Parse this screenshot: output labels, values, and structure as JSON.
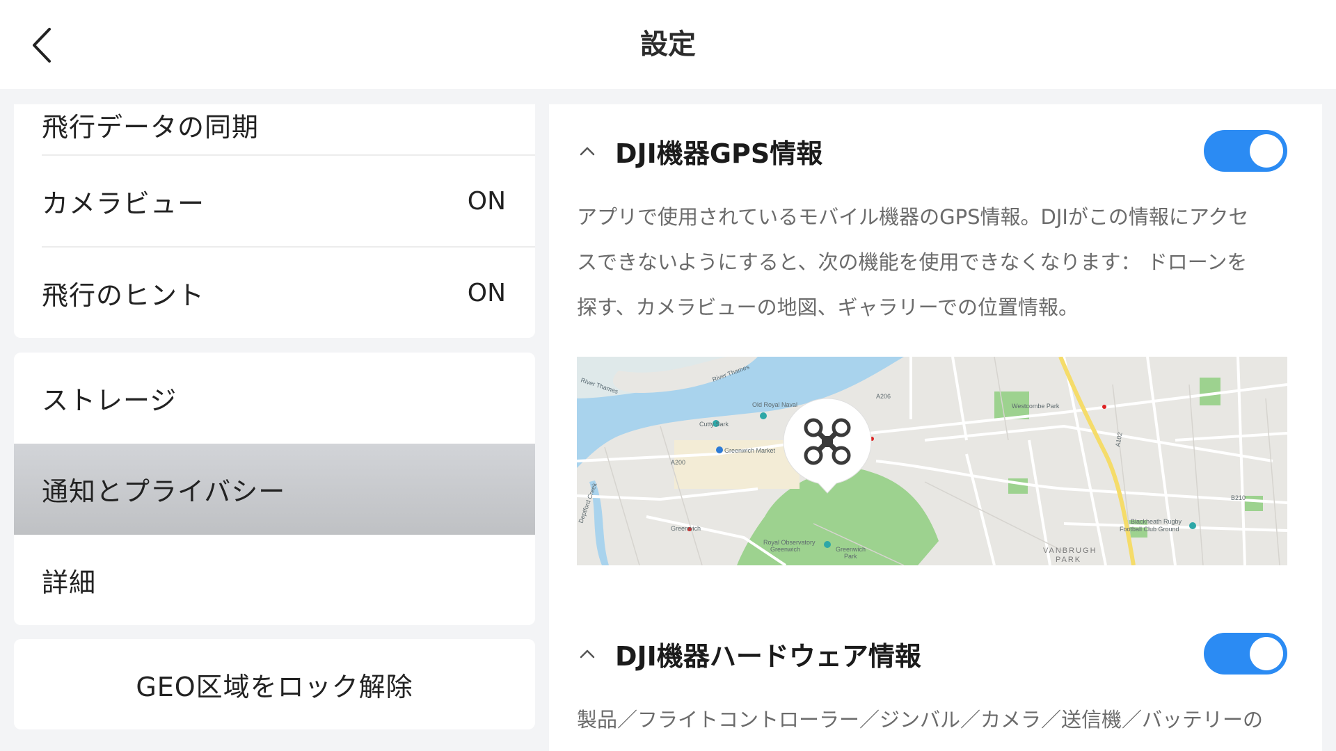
{
  "header": {
    "title": "設定"
  },
  "menu": {
    "partial_item": "飛行データの同期",
    "items": [
      {
        "label": "カメラビュー",
        "value": "ON"
      },
      {
        "label": "飛行のヒント",
        "value": "ON"
      }
    ],
    "group2": [
      {
        "label": "ストレージ"
      },
      {
        "label": "通知とプライバシー",
        "selected": true
      },
      {
        "label": "詳細"
      }
    ],
    "geo_button": "GEO区域をロック解除"
  },
  "sections": [
    {
      "title": "DJI機器GPS情報",
      "enabled": true,
      "description_lines": [
        "アプリで使用されているモバイル機器のGPS情報。DJIがこの情報にアクセ",
        "スできないようにすると、次の機能を使用できなくなります： ドローンを",
        "探す、カメラビューの地図、ギャラリーでの位置情報。"
      ]
    },
    {
      "title": "DJI機器ハードウェア情報",
      "enabled": true,
      "description_lines": [
        "製品／フライトコントローラー／ジンバル／カメラ／送信機／バッテリーの"
      ]
    }
  ],
  "map_labels": {
    "river1": "River Thames",
    "river2": "River Thames",
    "old_royal": "Old Royal Naval",
    "cutty": "Cutty Sark",
    "market": "Greenwich Market",
    "westcombe": "Westcombe Park",
    "blackheath1": "Blackheath Rugby",
    "blackheath2": "Football Club Ground",
    "vanbrugh1": "VANBRUGH",
    "vanbrugh2": "PARK",
    "observatory1": "Royal Observatory",
    "observatory2": "Greenwich",
    "gpark1": "Greenwich",
    "gpark2": "Park",
    "greenwich": "Greenwich",
    "a102": "A102",
    "a206": "A206",
    "a200": "A200",
    "b210": "B210",
    "deptford": "Deptford Creek"
  },
  "colors": {
    "accent": "#2b8bf3",
    "selected_row": "#c6c8cb",
    "water": "#a9d3ed",
    "park": "#9dd28f",
    "highway": "#f5dc6a"
  },
  "icons": {
    "back": "chevron-left-icon",
    "collapse": "chevron-up-icon",
    "drone": "drone-icon"
  }
}
